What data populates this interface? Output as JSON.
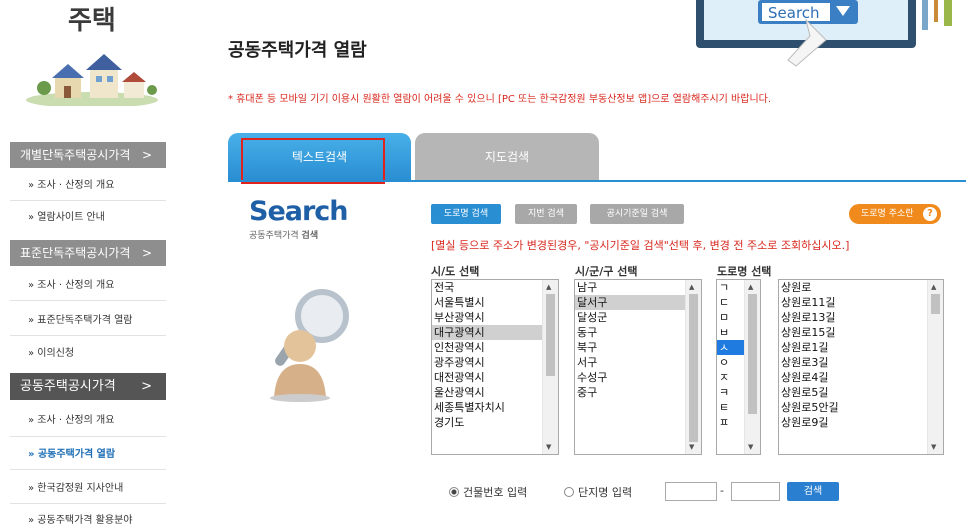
{
  "sidebar": {
    "title": "주택",
    "sections": [
      {
        "label": "개별단독주택공시가격",
        "arrow": ">",
        "items": [
          "» 조사 · 산정의 개요",
          "» 열람사이트 안내"
        ]
      },
      {
        "label": "표준단독주택공시가격",
        "arrow": ">",
        "items": [
          "» 조사 · 산정의 개요",
          "» 표준단독주택가격 열람",
          "» 이의신청"
        ]
      },
      {
        "label": "공동주택공시가격",
        "arrow": ">",
        "items": [
          "» 조사 · 산정의 개요",
          "» 공동주택가격 열람",
          "» 한국감정원 지사안내",
          "» 공동주택가격 활용분야"
        ]
      }
    ]
  },
  "header": {
    "monitor_text": "Search",
    "page_title": "공동주택가격 열람",
    "notice": "* 휴대폰 등 모바일 기기 이용시 원활한 열람이 어려울 수 있으니 [PC 또는 한국감정원 부동산정보 앱]으로 열람해주시기 바랍니다."
  },
  "tabs": [
    {
      "label": "텍스트검색",
      "active": true
    },
    {
      "label": "지도검색",
      "active": false
    }
  ],
  "search": {
    "logo": "Search",
    "sub_normal": "공동주택가격 ",
    "sub_bold": "검색",
    "buttons": [
      "도로명 검색",
      "지번 검색",
      "공시기준일 검색"
    ],
    "help_label": "도로명 주소란",
    "help_q": "?",
    "warning": "[멸실 등으로 주소가 변경된경우, \"공시기준일 검색\"선택 후, 변경 전 주소로 조회하십시오.]",
    "col_sido": "시/도 선택",
    "col_sigungu": "시/군/구 선택",
    "col_road": "도로명 선택",
    "sido": [
      "전국",
      "서울특별시",
      "부산광역시",
      "대구광역시",
      "인천광역시",
      "광주광역시",
      "대전광역시",
      "울산광역시",
      "세종특별자치시",
      "경기도"
    ],
    "sido_selected": 3,
    "sigungu": [
      "남구",
      "달서구",
      "달성군",
      "동구",
      "북구",
      "서구",
      "수성구",
      "중구"
    ],
    "sigungu_selected": 1,
    "initials": [
      "ㄱ",
      "ㄷ",
      "ㅁ",
      "ㅂ",
      "ㅅ",
      "ㅇ",
      "ㅈ",
      "ㅋ",
      "ㅌ",
      "ㅍ"
    ],
    "initials_selected": 4,
    "roads": [
      "상원로",
      "상원로11길",
      "상원로13길",
      "상원로15길",
      "상원로1길",
      "상원로3길",
      "상원로4길",
      "상원로5길",
      "상원로5안길",
      "상원로9길"
    ],
    "radio_building": "건물번호 입력",
    "radio_complex": "단지명 입력",
    "dash": "-",
    "go": "검색"
  },
  "colors": {
    "accent": "#2a8ed3",
    "warning": "#d8281e",
    "orange": "#f08a1d"
  }
}
